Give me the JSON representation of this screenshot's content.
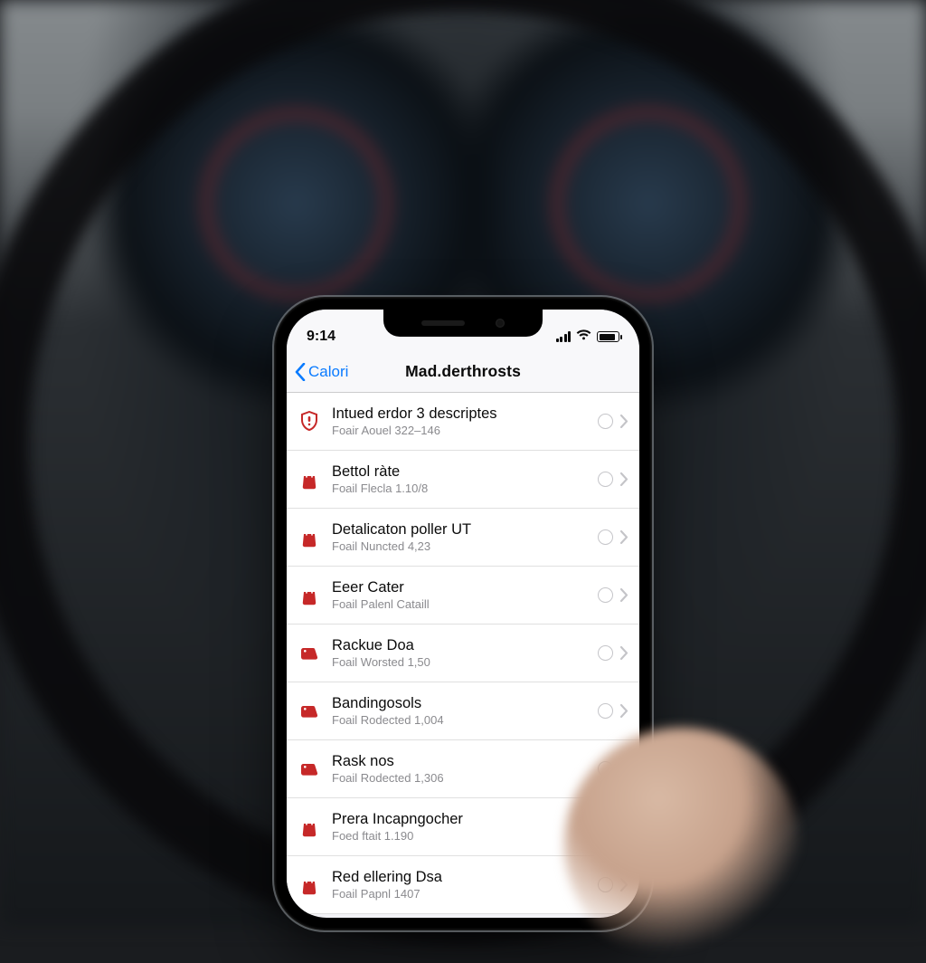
{
  "status": {
    "time": "9:14"
  },
  "nav": {
    "back_label": "Calori",
    "title": "Mad.derthrosts"
  },
  "colors": {
    "accent": "#0a7bff",
    "icon_red": "#c62828"
  },
  "items": [
    {
      "icon": "shield",
      "title": "Intued erdor 3 descriptes",
      "subtitle": "Foair Aouel 322–146"
    },
    {
      "icon": "bag",
      "title": "Bettol ràte",
      "subtitle": "Foail Flecla 1.10/8"
    },
    {
      "icon": "bag",
      "title": "Detalicaton poller UT",
      "subtitle": "Foail Nuncted 4,23"
    },
    {
      "icon": "bag",
      "title": "Eeer Cater",
      "subtitle": "Foail Palenl Cataill"
    },
    {
      "icon": "tag",
      "title": "Rackue Doa",
      "subtitle": "Foail Worsted 1,50"
    },
    {
      "icon": "tag",
      "title": "Bandingosols",
      "subtitle": "Foail Rodected 1,004"
    },
    {
      "icon": "tag",
      "title": "Rask nos",
      "subtitle": "Foail Rodected 1,306"
    },
    {
      "icon": "bag",
      "title": "Prera Incapngocher",
      "subtitle": "Foed ftait 1.190"
    },
    {
      "icon": "bag",
      "title": "Red ellering Dsa",
      "subtitle": "Foail Papnl 1407"
    }
  ]
}
